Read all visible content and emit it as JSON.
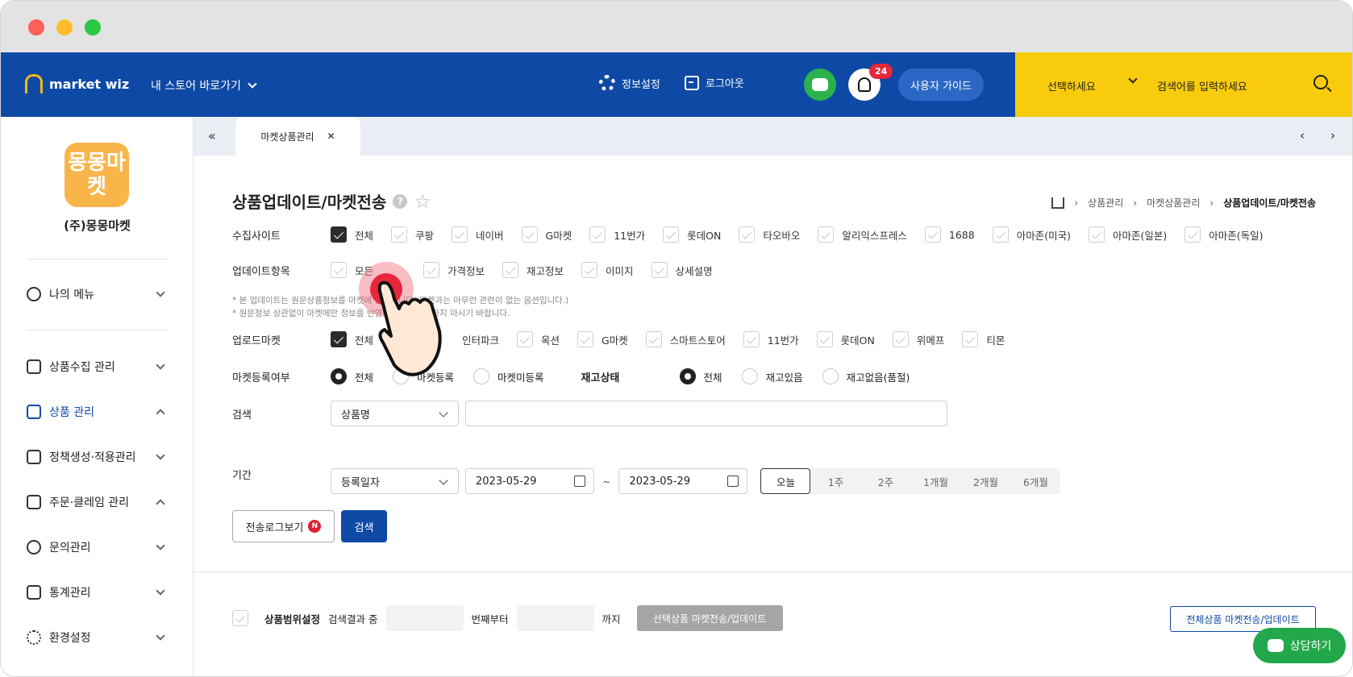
{
  "header": {
    "logo": "market wiz",
    "store_link": "내 스토어 바로가기",
    "settings": "정보설정",
    "logout": "로그아웃",
    "notification_count": "24",
    "guide": "사용자 가이드",
    "search_select": "선택하세요",
    "search_placeholder": "검색어를 입력하세요"
  },
  "sidebar": {
    "avatar_text": "몽몽마켓",
    "company": "(주)몽몽마켓",
    "items": [
      {
        "label": "나의 메뉴",
        "icon": "user-icon"
      },
      {
        "label": "상품수집 관리",
        "icon": "cart-icon"
      },
      {
        "label": "상품 관리",
        "icon": "box-icon"
      },
      {
        "label": "정책생성·적용관리",
        "icon": "document-icon"
      },
      {
        "label": "주문·클레임 관리",
        "icon": "basket-icon"
      },
      {
        "label": "문의관리",
        "icon": "chat-icon"
      },
      {
        "label": "통계관리",
        "icon": "chart-icon"
      },
      {
        "label": "환경설정",
        "icon": "gear-icon"
      }
    ]
  },
  "tabs": {
    "active": "마켓상품관리"
  },
  "page": {
    "title": "상품업데이트/마켓전송",
    "breadcrumb": [
      "상품관리",
      "마켓상품관리",
      "상품업데이트/마켓전송"
    ]
  },
  "form": {
    "collect_label": "수집사이트",
    "collect_sites": [
      "전체",
      "쿠팡",
      "네이버",
      "G마켓",
      "11번가",
      "롯데ON",
      "타오바오",
      "알리익스프레스",
      "1688",
      "아마존(미국)",
      "아마존(일본)",
      "아마존(독일)"
    ],
    "update_label": "업데이트항목",
    "update_items": [
      "모든",
      "가격정보",
      "재고정보",
      "이미지",
      "상세설명"
    ],
    "note1": "* 본 업데이트는 원문상품정보를 마켓에 반영합니다.(마켓과는 아무런 관련이 없는 옵션입니다.)",
    "note2": "* 원문정보 상관없이 마켓에만 정보를 반영하시려면 체크하지 마시기 바랍니다.",
    "upload_label": "업로드마켓",
    "upload_markets": [
      "전체",
      "",
      "인터파크",
      "옥션",
      "G마켓",
      "스마트스토어",
      "11번가",
      "롯데ON",
      "위메프",
      "티몬"
    ],
    "regist_label": "마켓등록여부",
    "regist_opts": [
      "전체",
      "마켓등록",
      "마켓미등록"
    ],
    "stock_label": "재고상태",
    "stock_opts": [
      "전체",
      "재고있음",
      "재고없음(품절)"
    ],
    "search_label": "검색",
    "search_select": "상품명",
    "period_label": "기간",
    "period_select": "등록일자",
    "date_from": "2023-05-29",
    "tilde": "~",
    "date_to": "2023-05-29",
    "periods": [
      "오늘",
      "1주",
      "2주",
      "1개월",
      "2개월",
      "6개월"
    ],
    "log_button": "전송로그보기",
    "log_badge": "N",
    "search_button": "검색"
  },
  "bottom": {
    "range_label": "상품범위설정",
    "result_label": "검색결과 중",
    "from_label": "번째부터",
    "to_label": "까지",
    "send_selected": "선택상품 마켓전송/업데이트",
    "send_all": "전체상품 마켓전송/업데이트"
  },
  "consult": "상담하기"
}
